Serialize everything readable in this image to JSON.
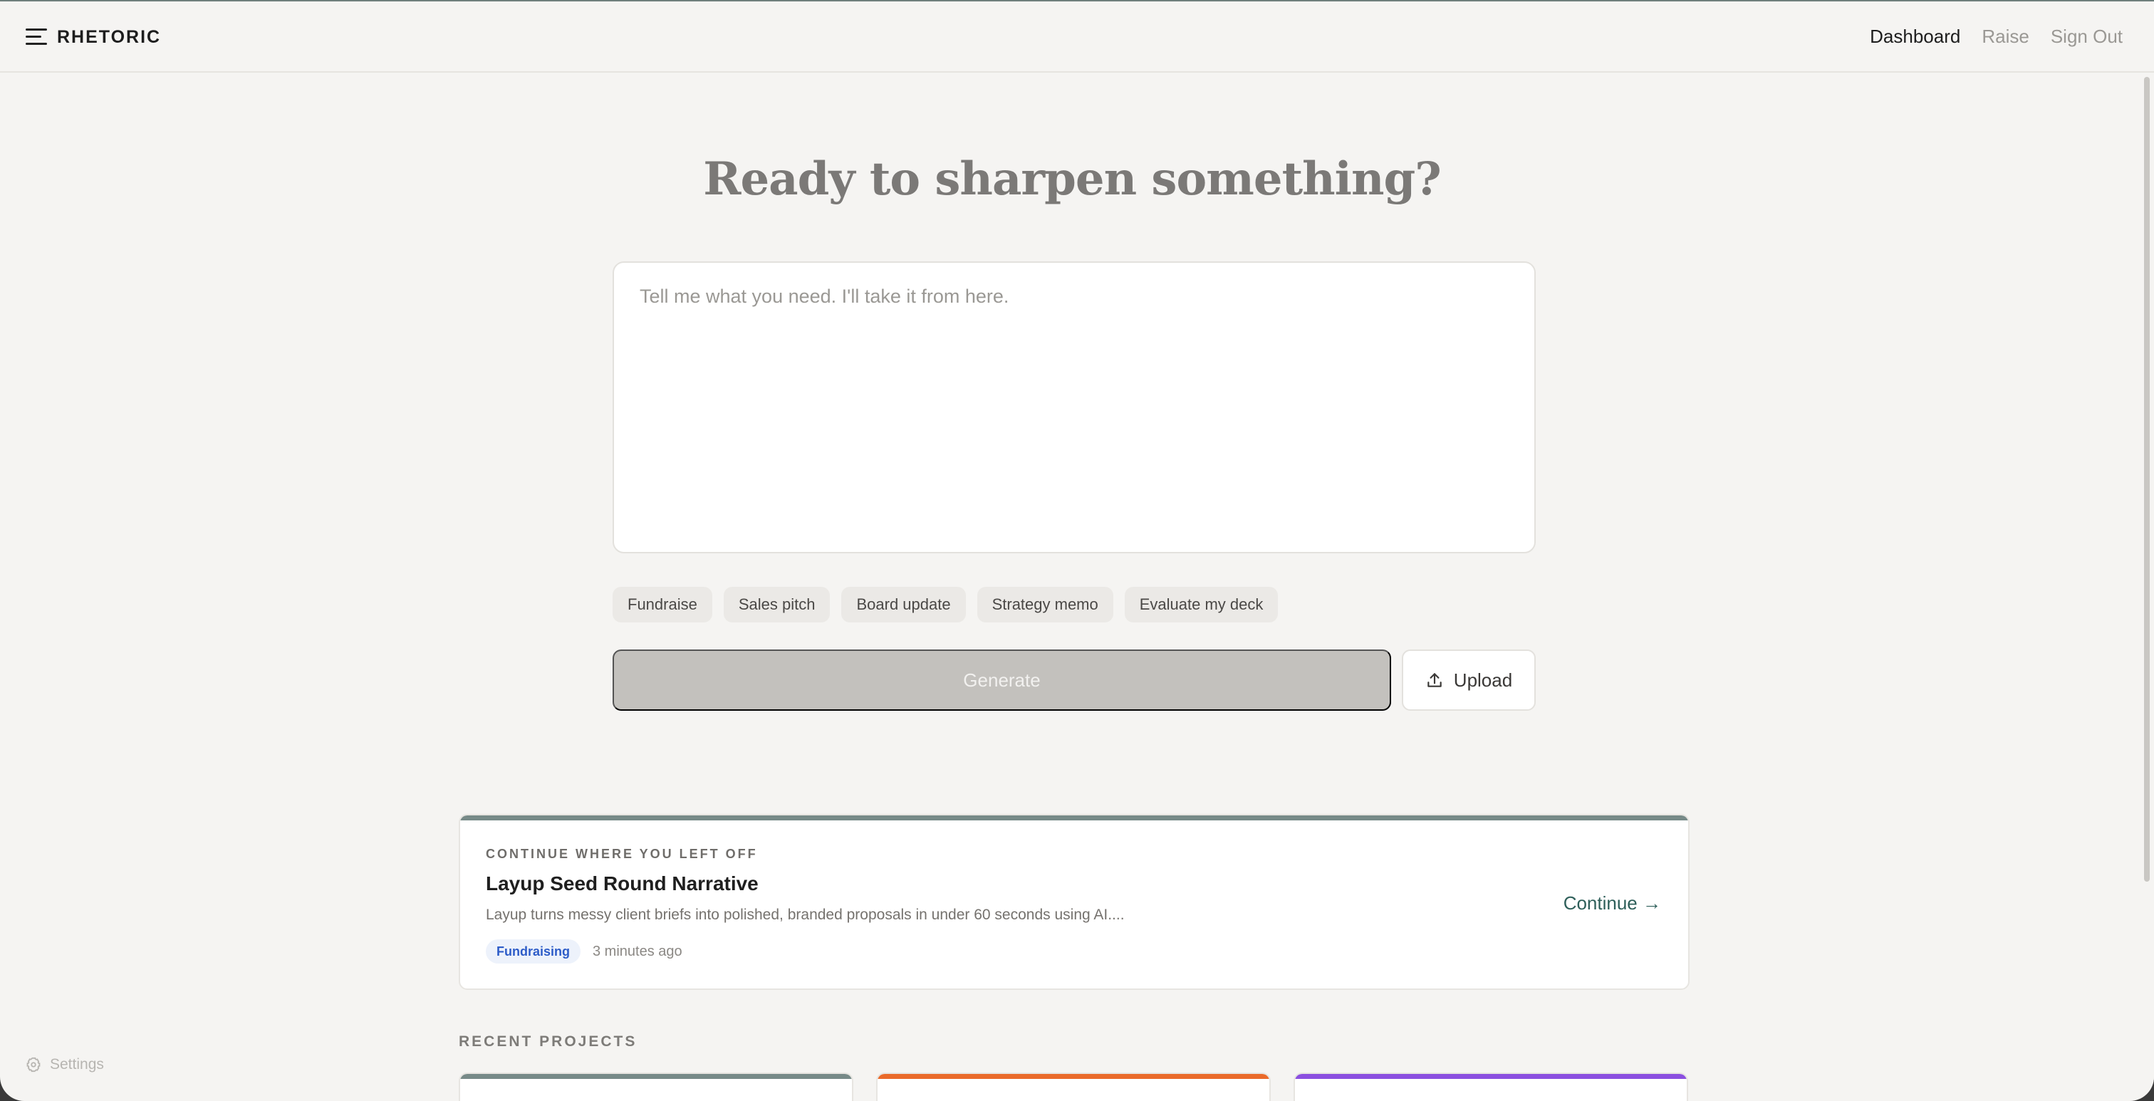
{
  "header": {
    "brand": "RHETORIC",
    "nav": [
      {
        "label": "Dashboard",
        "active": true
      },
      {
        "label": "Raise",
        "active": false
      },
      {
        "label": "Sign Out",
        "active": false
      }
    ]
  },
  "hero": {
    "headline": "Ready to sharpen something?",
    "prompt_placeholder": "Tell me what you need. I'll take it from here.",
    "chips": [
      "Fundraise",
      "Sales pitch",
      "Board update",
      "Strategy memo",
      "Evaluate my deck"
    ],
    "generate_label": "Generate",
    "upload_label": "Upload"
  },
  "continue_card": {
    "eyebrow": "CONTINUE WHERE YOU LEFT OFF",
    "title": "Layup Seed Round Narrative",
    "description": "Layup turns messy client briefs into polished, branded proposals in under 60 seconds using AI....",
    "tag": "Fundraising",
    "time": "3 minutes ago",
    "continue_label": "Continue →",
    "accent_color": "#778a88"
  },
  "recent": {
    "label": "RECENT PROJECTS",
    "cards": [
      {
        "accent": "#778a88"
      },
      {
        "accent": "#ea6a2a"
      },
      {
        "accent": "#8b4fe0"
      }
    ]
  },
  "settings_label": "Settings",
  "colors": {
    "background": "#f5f4f2",
    "tag_blue": "#2d5cc8",
    "continue_link": "#2e5f5a"
  }
}
